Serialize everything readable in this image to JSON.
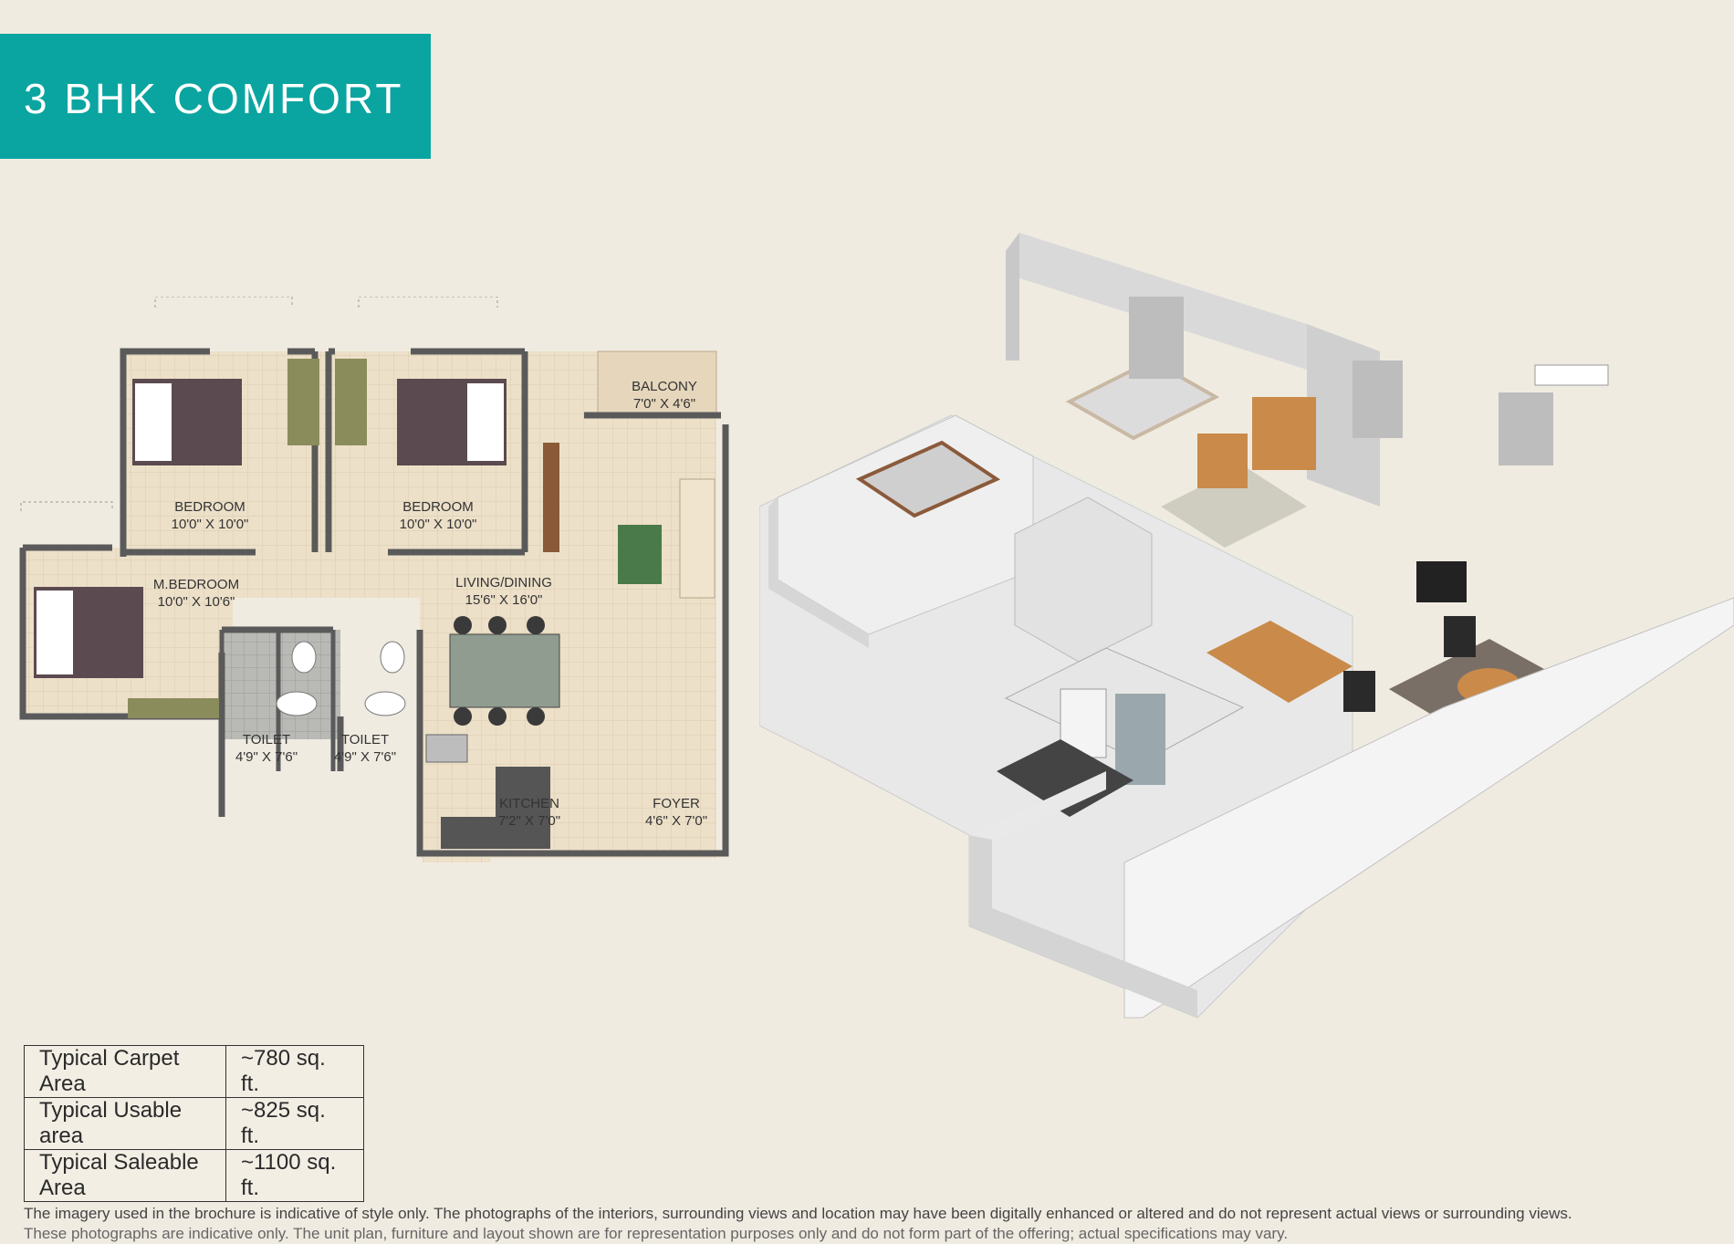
{
  "header": {
    "title": "3 BHK COMFORT"
  },
  "floor_plan": {
    "rooms": [
      {
        "name": "BEDROOM",
        "size": "10'0\" X 10'0\""
      },
      {
        "name": "BEDROOM",
        "size": "10'0\" X 10'0\""
      },
      {
        "name": "M.BEDROOM",
        "size": "10'0\" X 10'6\""
      },
      {
        "name": "BALCONY",
        "size": "7'0\" X 4'6\""
      },
      {
        "name": "LIVING/DINING",
        "size": "15'6\" X 16'0\""
      },
      {
        "name": "TOILET",
        "size": "4'9\" X 7'6\""
      },
      {
        "name": "TOILET",
        "size": "4'9\" X 7'6\""
      },
      {
        "name": "KITCHEN",
        "size": "7'2\" X 7'0\""
      },
      {
        "name": "FOYER",
        "size": "4'6\" X 7'0\""
      }
    ]
  },
  "area_table": [
    {
      "label": "Typical Carpet Area",
      "value": "~780 sq. ft."
    },
    {
      "label": "Typical Usable area",
      "value": "~825 sq. ft."
    },
    {
      "label": "Typical Saleable Area",
      "value": "~1100 sq. ft."
    }
  ],
  "disclaimer": {
    "line1": "The imagery used in the brochure is indicative of style only. The photographs of the interiors, surrounding views and location may have been digitally enhanced or altered and do not represent actual views or surrounding views.",
    "line2": "These photographs are indicative only. The unit plan, furniture and layout shown are for representation purposes only and do not form part of the offering; actual specifications may vary."
  }
}
